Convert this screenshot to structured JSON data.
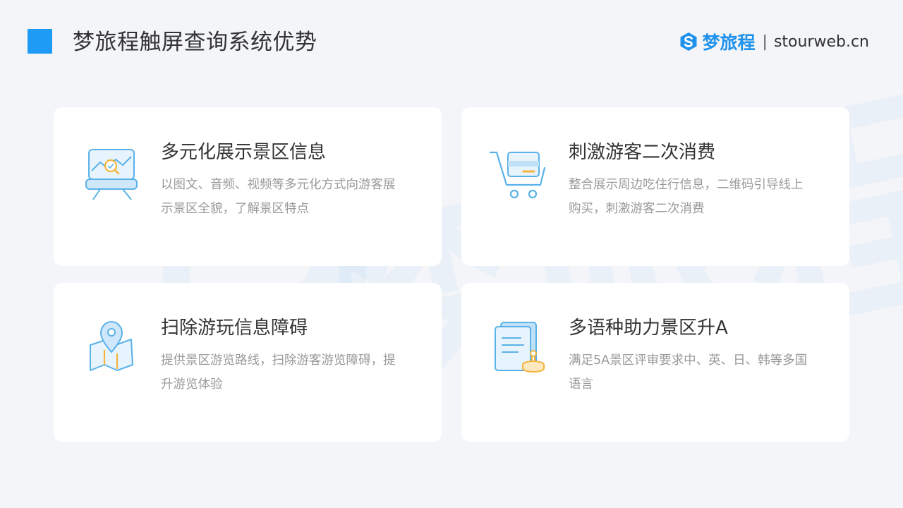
{
  "header": {
    "title": "梦旅程触屏查询系统优势",
    "brand_name": "梦旅程",
    "brand_separator": "|",
    "brand_url": "stourweb.cn"
  },
  "watermark": {
    "text": "梦旅程"
  },
  "colors": {
    "accent": "#1e9bf5",
    "brand": "#2092ec",
    "icon_blue": "#5ab2e8",
    "icon_orange": "#f5b33b"
  },
  "cards": [
    {
      "icon": "monitor-chart-icon",
      "title": "多元化展示景区信息",
      "description": "以图文、音频、视频等多元化方式向游客展示景区全貌，了解景区特点"
    },
    {
      "icon": "shopping-cart-icon",
      "title": "刺激游客二次消费",
      "description": "整合展示周边吃住行信息，二维码引导线上购买，刺激游客二次消费"
    },
    {
      "icon": "map-pin-icon",
      "title": "扫除游玩信息障碍",
      "description": "提供景区游览路线，扫除游客游览障碍，提升游览体验"
    },
    {
      "icon": "document-stamp-icon",
      "title": "多语种助力景区升A",
      "description": "满足5A景区评审要求中、英、日、韩等多国语言"
    }
  ]
}
